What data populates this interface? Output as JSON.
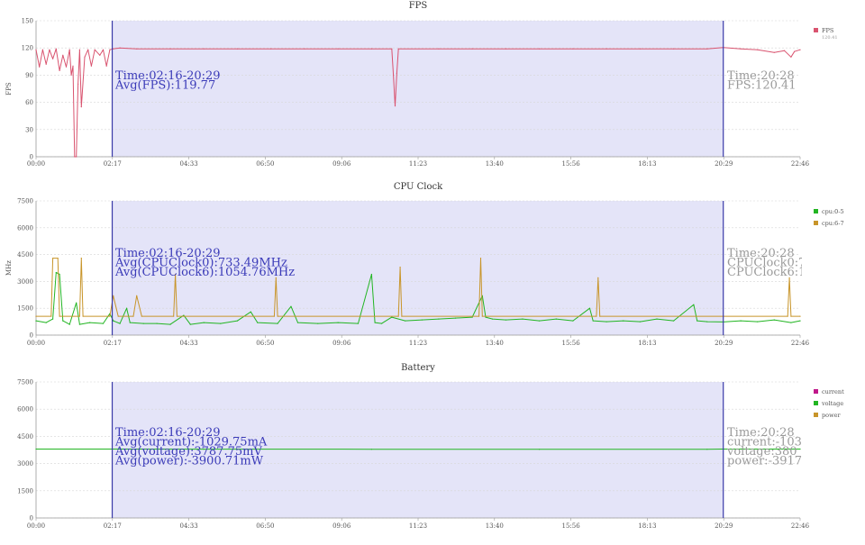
{
  "charts": [
    {
      "id": "fps",
      "title": "FPS",
      "ylabel": "FPS",
      "ylim": [
        0,
        150
      ],
      "yticks": [
        "0",
        "30",
        "60",
        "90",
        "120",
        "150"
      ],
      "xticks": [
        "00:00",
        "02:17",
        "04:33",
        "06:50",
        "09:06",
        "11:23",
        "13:40",
        "15:56",
        "18:13",
        "20:29",
        "22:46"
      ],
      "legend": [
        {
          "name": "FPS",
          "sub": "120.41",
          "color": "#d9536f"
        }
      ],
      "selection_note": [
        "Time:02:16-20:29",
        "Avg(FPS):119.77"
      ],
      "cursor_note": [
        "Time:20:28",
        "FPS:120.41"
      ]
    },
    {
      "id": "cpu",
      "title": "CPU Clock",
      "ylabel": "MHz",
      "ylim": [
        0,
        7500
      ],
      "yticks": [
        "0",
        "1500",
        "3000",
        "4500",
        "6000",
        "7500"
      ],
      "xticks": [
        "00:00",
        "02:17",
        "04:33",
        "06:50",
        "09:06",
        "11:23",
        "13:40",
        "15:56",
        "18:13",
        "20:29",
        "22:46"
      ],
      "legend": [
        {
          "name": "cpu:0-5",
          "color": "#22b522"
        },
        {
          "name": "cpu:6-7",
          "color": "#c8952a"
        }
      ],
      "selection_note": [
        "Time:02:16-20:29",
        "Avg(CPUClock0):733.49MHz",
        "Avg(CPUClock6):1054.76MHz"
      ],
      "cursor_note": [
        "Time:20:28",
        "CPUClock0:7",
        "CPUClock6:10"
      ]
    },
    {
      "id": "battery",
      "title": "Battery",
      "ylabel": "",
      "ylim": [
        0,
        7500
      ],
      "yticks": [
        "0",
        "1500",
        "3000",
        "4500",
        "6000",
        "7500"
      ],
      "xticks": [
        "00:00",
        "02:17",
        "04:33",
        "06:50",
        "09:06",
        "11:23",
        "13:40",
        "15:56",
        "18:13",
        "20:29",
        "22:46"
      ],
      "legend": [
        {
          "name": "current",
          "color": "#c0188a"
        },
        {
          "name": "voltage",
          "color": "#22b522"
        },
        {
          "name": "power",
          "color": "#c8952a"
        }
      ],
      "selection_note": [
        "Time:02:16-20:29",
        "Avg(current):-1029.75mA",
        "Avg(voltage):3787.75mV",
        "Avg(power):-3900.71mW"
      ],
      "cursor_note": [
        "Time:20:28",
        "current:-103",
        "voltage:380",
        "power:-3917."
      ]
    }
  ],
  "chart_data": [
    {
      "type": "line",
      "title": "FPS",
      "ylabel": "FPS",
      "ylim": [
        0,
        150
      ],
      "x_unit": "minutes",
      "xlim": [
        0,
        22.77
      ],
      "selection": [
        2.27,
        20.48
      ],
      "series": [
        {
          "name": "FPS",
          "color": "#d9536f",
          "points": [
            [
              0.0,
              118
            ],
            [
              0.1,
              99
            ],
            [
              0.2,
              118
            ],
            [
              0.3,
              102
            ],
            [
              0.4,
              118
            ],
            [
              0.5,
              108
            ],
            [
              0.6,
              119
            ],
            [
              0.7,
              95
            ],
            [
              0.8,
              112
            ],
            [
              0.9,
              99
            ],
            [
              1.0,
              118
            ],
            [
              1.05,
              90
            ],
            [
              1.1,
              100
            ],
            [
              1.15,
              0
            ],
            [
              1.2,
              0
            ],
            [
              1.25,
              80
            ],
            [
              1.3,
              118
            ],
            [
              1.35,
              55
            ],
            [
              1.45,
              110
            ],
            [
              1.55,
              118
            ],
            [
              1.65,
              100
            ],
            [
              1.75,
              118
            ],
            [
              1.9,
              112
            ],
            [
              2.0,
              118
            ],
            [
              2.1,
              100
            ],
            [
              2.2,
              118
            ],
            [
              2.3,
              119
            ],
            [
              2.5,
              120
            ],
            [
              3.0,
              119
            ],
            [
              4.0,
              119
            ],
            [
              5.0,
              119
            ],
            [
              6.0,
              119
            ],
            [
              7.0,
              119
            ],
            [
              8.0,
              119
            ],
            [
              9.0,
              119
            ],
            [
              10.0,
              119
            ],
            [
              10.6,
              119
            ],
            [
              10.65,
              90
            ],
            [
              10.7,
              56
            ],
            [
              10.75,
              92
            ],
            [
              10.8,
              119
            ],
            [
              12.0,
              119
            ],
            [
              13.0,
              119
            ],
            [
              14.0,
              119
            ],
            [
              15.0,
              119
            ],
            [
              16.0,
              119
            ],
            [
              17.0,
              119
            ],
            [
              18.0,
              119
            ],
            [
              19.0,
              119
            ],
            [
              20.0,
              119
            ],
            [
              20.48,
              120.41
            ],
            [
              21.0,
              119
            ],
            [
              21.5,
              118
            ],
            [
              22.0,
              115
            ],
            [
              22.3,
              117
            ],
            [
              22.5,
              110
            ],
            [
              22.6,
              116
            ],
            [
              22.77,
              118
            ]
          ]
        }
      ]
    },
    {
      "type": "line",
      "title": "CPU Clock",
      "ylabel": "MHz",
      "ylim": [
        0,
        7500
      ],
      "x_unit": "minutes",
      "xlim": [
        0,
        22.77
      ],
      "selection": [
        2.27,
        20.48
      ],
      "series": [
        {
          "name": "cpu:0-5",
          "color": "#22b522",
          "points": [
            [
              0.0,
              800
            ],
            [
              0.3,
              700
            ],
            [
              0.5,
              900
            ],
            [
              0.6,
              3500
            ],
            [
              0.7,
              3400
            ],
            [
              0.8,
              800
            ],
            [
              1.0,
              600
            ],
            [
              1.2,
              1800
            ],
            [
              1.3,
              600
            ],
            [
              1.6,
              700
            ],
            [
              2.0,
              650
            ],
            [
              2.2,
              1200
            ],
            [
              2.3,
              800
            ],
            [
              2.5,
              650
            ],
            [
              2.7,
              1500
            ],
            [
              2.8,
              700
            ],
            [
              3.2,
              650
            ],
            [
              3.6,
              650
            ],
            [
              4.0,
              600
            ],
            [
              4.4,
              1100
            ],
            [
              4.6,
              600
            ],
            [
              5.0,
              700
            ],
            [
              5.5,
              650
            ],
            [
              6.0,
              800
            ],
            [
              6.4,
              1300
            ],
            [
              6.6,
              700
            ],
            [
              7.2,
              650
            ],
            [
              7.6,
              1600
            ],
            [
              7.8,
              700
            ],
            [
              8.4,
              650
            ],
            [
              9.0,
              700
            ],
            [
              9.6,
              650
            ],
            [
              10.0,
              3400
            ],
            [
              10.1,
              700
            ],
            [
              10.3,
              650
            ],
            [
              10.6,
              1000
            ],
            [
              11.0,
              800
            ],
            [
              11.5,
              850
            ],
            [
              12.0,
              900
            ],
            [
              12.5,
              950
            ],
            [
              13.0,
              1000
            ],
            [
              13.3,
              2200
            ],
            [
              13.4,
              1000
            ],
            [
              13.6,
              900
            ],
            [
              14.0,
              850
            ],
            [
              14.5,
              900
            ],
            [
              15.0,
              800
            ],
            [
              15.5,
              900
            ],
            [
              16.0,
              800
            ],
            [
              16.5,
              1500
            ],
            [
              16.6,
              800
            ],
            [
              17.0,
              750
            ],
            [
              17.5,
              800
            ],
            [
              18.0,
              750
            ],
            [
              18.5,
              900
            ],
            [
              19.0,
              800
            ],
            [
              19.6,
              1700
            ],
            [
              19.7,
              800
            ],
            [
              20.0,
              750
            ],
            [
              20.48,
              733
            ],
            [
              21.0,
              800
            ],
            [
              21.5,
              750
            ],
            [
              22.0,
              850
            ],
            [
              22.5,
              700
            ],
            [
              22.77,
              800
            ]
          ]
        },
        {
          "name": "cpu:6-7",
          "color": "#c8952a",
          "points": [
            [
              0.0,
              1050
            ],
            [
              0.45,
              1050
            ],
            [
              0.5,
              4300
            ],
            [
              0.65,
              4300
            ],
            [
              0.7,
              1050
            ],
            [
              1.3,
              1050
            ],
            [
              1.35,
              4300
            ],
            [
              1.4,
              1050
            ],
            [
              2.2,
              1050
            ],
            [
              2.3,
              2200
            ],
            [
              2.45,
              1050
            ],
            [
              2.9,
              1050
            ],
            [
              3.0,
              2200
            ],
            [
              3.15,
              1050
            ],
            [
              4.1,
              1050
            ],
            [
              4.15,
              3400
            ],
            [
              4.2,
              1050
            ],
            [
              7.1,
              1050
            ],
            [
              7.15,
              3200
            ],
            [
              7.2,
              1050
            ],
            [
              10.8,
              1050
            ],
            [
              10.85,
              3800
            ],
            [
              10.9,
              1050
            ],
            [
              13.2,
              1050
            ],
            [
              13.25,
              4300
            ],
            [
              13.3,
              1050
            ],
            [
              16.7,
              1050
            ],
            [
              16.75,
              3200
            ],
            [
              16.8,
              1050
            ],
            [
              20.48,
              1054
            ],
            [
              22.4,
              1050
            ],
            [
              22.45,
              3200
            ],
            [
              22.5,
              1050
            ],
            [
              22.77,
              1050
            ]
          ]
        }
      ]
    },
    {
      "type": "line",
      "title": "Battery",
      "ylim": [
        0,
        7500
      ],
      "x_unit": "minutes",
      "xlim": [
        0,
        22.77
      ],
      "selection": [
        2.27,
        20.48
      ],
      "series": [
        {
          "name": "voltage",
          "color": "#22b522",
          "points": [
            [
              0.0,
              3800
            ],
            [
              5.0,
              3795
            ],
            [
              10.0,
              3790
            ],
            [
              15.0,
              3785
            ],
            [
              20.0,
              3790
            ],
            [
              20.48,
              3800
            ],
            [
              22.77,
              3800
            ]
          ]
        }
      ]
    }
  ]
}
